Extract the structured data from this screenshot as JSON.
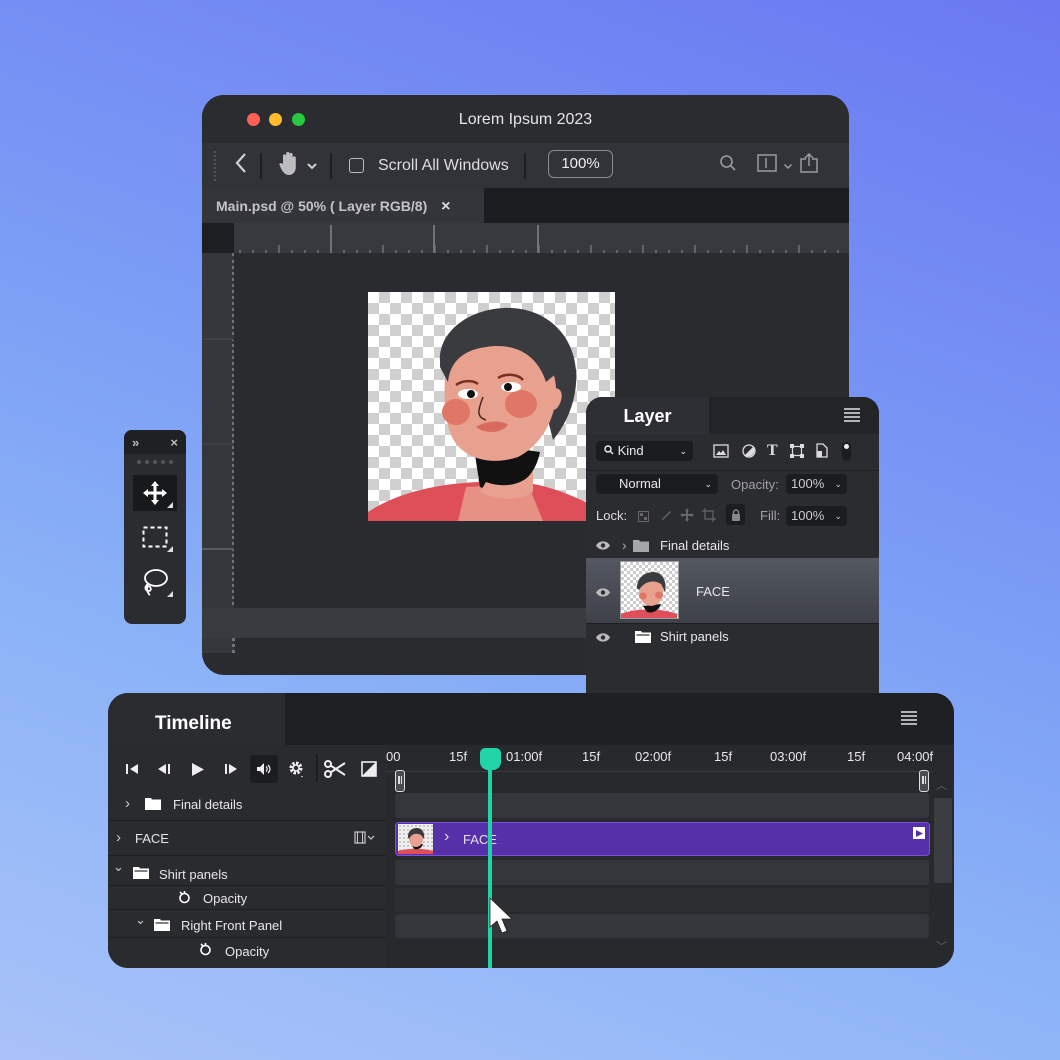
{
  "window": {
    "title": "Lorem Ipsum 2023",
    "toolbar": {
      "scroll_all_windows_label": "Scroll All Windows",
      "scroll_all_windows_checked": false,
      "zoom_value": "100%"
    },
    "document_tab": {
      "label": "Main.psd @ 50% ( Layer RGB/8)",
      "close_glyph": "×"
    }
  },
  "tools_panel": {
    "expand_glyph": "»",
    "close_glyph": "×",
    "tools": [
      "move-tool",
      "rectangular-marquee-tool",
      "lasso-tool"
    ],
    "active_tool": "move-tool"
  },
  "layer_panel": {
    "title": "Layer",
    "filter": {
      "label": "Kind"
    },
    "filter_icons": [
      "image-filter-icon",
      "adjustment-filter-icon",
      "type-filter-icon",
      "shape-filter-icon",
      "smart-object-filter-icon"
    ],
    "blend_mode": "Normal",
    "opacity_label": "Opacity:",
    "opacity_value": "100%",
    "lock_label": "Lock:",
    "fill_label": "Fill:",
    "fill_value": "100%",
    "layers": [
      {
        "name": "Final details",
        "type": "group",
        "expanded": false,
        "visible": true
      },
      {
        "name": "FACE",
        "type": "layer",
        "selected": true,
        "visible": true
      },
      {
        "name": "Shirt panels",
        "type": "group",
        "visible": true
      }
    ]
  },
  "timeline": {
    "title": "Timeline",
    "ruler_ticks": [
      "00",
      "15f",
      "01:00f",
      "15f",
      "02:00f",
      "15f",
      "03:00f",
      "15f",
      "04:00f"
    ],
    "rows": [
      {
        "label": "Final details",
        "type": "group",
        "expanded": false
      },
      {
        "label": "FACE",
        "type": "layer",
        "expanded": false
      },
      {
        "label": "Shirt panels",
        "type": "group",
        "expanded": true
      },
      {
        "label": "Opacity",
        "type": "property"
      },
      {
        "label": "Right Front Panel",
        "type": "group",
        "expanded": true
      },
      {
        "label": "Opacity",
        "type": "property"
      }
    ],
    "clip_label": "FACE",
    "playhead_time": "00:20f"
  },
  "colors": {
    "accent_playhead": "#20d4a7",
    "clip_purple": "#5630a8",
    "traffic_red": "#fe5f57",
    "traffic_yellow": "#febc2e",
    "traffic_green": "#28c840"
  }
}
